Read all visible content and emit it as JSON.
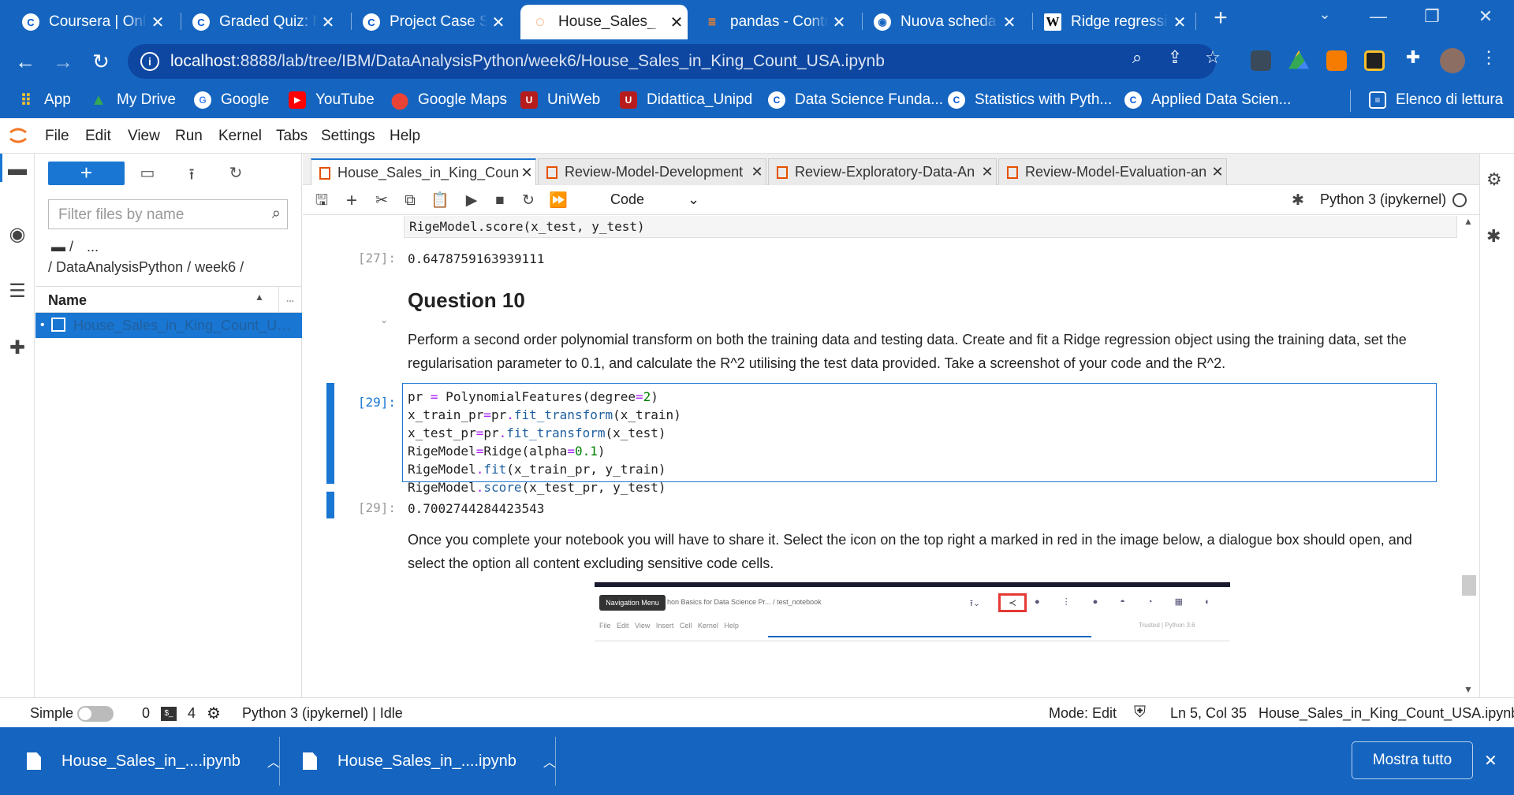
{
  "browser": {
    "tabs": [
      {
        "title": "Coursera | Onli",
        "icon": "coursera-icon"
      },
      {
        "title": "Graded Quiz: M",
        "icon": "coursera-icon"
      },
      {
        "title": "Project Case Sc",
        "icon": "coursera-icon"
      },
      {
        "title": "House_Sales_",
        "icon": "jupyter-icon",
        "active": true
      },
      {
        "title": "pandas - Contr",
        "icon": "stackoverflow-icon"
      },
      {
        "title": "Nuova scheda",
        "icon": "chrome-icon"
      },
      {
        "title": "Ridge regressio",
        "icon": "wikipedia-icon"
      }
    ],
    "url_host": "localhost",
    "url_path": ":8888/lab/tree/IBM/DataAnalysisPython/week6/House_Sales_in_King_Count_USA.ipynb",
    "bookmarks": [
      "App",
      "My Drive",
      "Google",
      "YouTube",
      "Google Maps",
      "UniWeb",
      "Didattica_Unipd",
      "Data Science Funda...",
      "Statistics with Pyth...",
      "Applied Data Scien..."
    ],
    "reading_list": "Elenco di lettura"
  },
  "jupyter": {
    "menu": [
      "File",
      "Edit",
      "View",
      "Run",
      "Kernel",
      "Tabs",
      "Settings",
      "Help"
    ],
    "filebrowser": {
      "filter_placeholder": "Filter files by name",
      "crumb_root": "/",
      "crumb_more": "...",
      "path": "/ DataAnalysisPython / week6 /",
      "name_header": "Name",
      "file": "House_Sales_in_King_Count_USA...."
    },
    "doc_tabs": [
      "House_Sales_in_King_Count_",
      "Review-Model-Development",
      "Review-Exploratory-Data-An",
      "Review-Model-Evaluation-an"
    ],
    "cell_type": "Code",
    "kernel": "Python 3 (ipykernel)",
    "cells": {
      "prev_code_tail": "RigeModel.score(x_test, y_test)",
      "out27_prompt": "[27]:",
      "out27_value": "0.6478759163939111",
      "q10_heading": "Question 10",
      "q10_text": "Perform a second order polynomial transform on both the training data and testing data. Create and fit a Ridge regression object using the training data, set the regularisation parameter to 0.1, and calculate the R^2 utilising the test data provided. Take a screenshot of your code and the R^2.",
      "in29_prompt": "[29]:",
      "out29_prompt": "[29]:",
      "out29_value": "0.7002744284423543",
      "share_text": "Once you complete your notebook you will have to share it. Select the icon on the top right a marked in red in the image below, a dialogue box should open, and select the option all content excluding sensitive code cells.",
      "img_nav_menu": "Navigation Menu",
      "img_breadcrumb": "hon Basics for Data Science Pr...  /  test_notebook",
      "img_menu": "File   Edit   View   Insert   Cell   Kernel   Help",
      "img_trusted": "Trusted | Python 3.6"
    },
    "status": {
      "mode_label": "Simple",
      "zero": "0",
      "four": "4",
      "kernel_status": "Python 3 (ipykernel) | Idle",
      "mode": "Mode: Edit",
      "cursor": "Ln 5, Col 35",
      "filename": "House_Sales_in_King_Count_USA.ipynb"
    }
  },
  "downloads": {
    "items": [
      "House_Sales_in_....ipynb",
      "House_Sales_in_....ipynb"
    ],
    "show_all": "Mostra tutto"
  }
}
